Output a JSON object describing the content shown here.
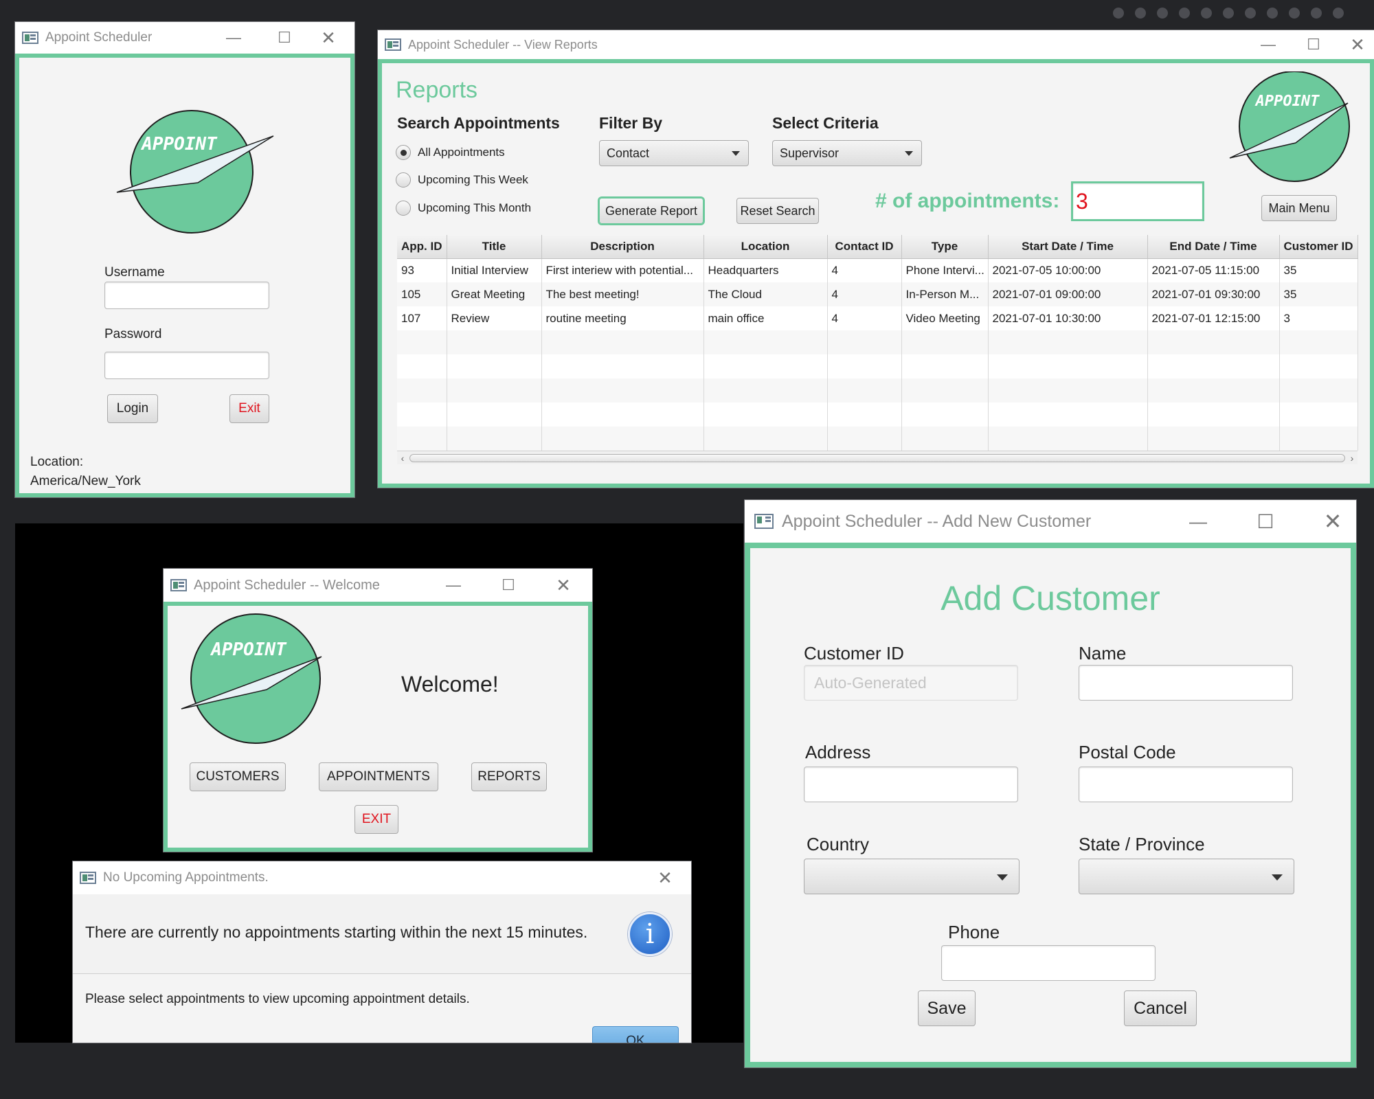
{
  "colors": {
    "accent": "#6cc99c",
    "background": "#242528",
    "danger": "#e0141e"
  },
  "logo": {
    "text": "APPOINT"
  },
  "login": {
    "title": "Appoint Scheduler",
    "username_label": "Username",
    "username_value": "",
    "password_label": "Password",
    "password_value": "",
    "login_button": "Login",
    "exit_button": "Exit",
    "location_label": "Location:",
    "location_value": "America/New_York"
  },
  "reports": {
    "window_title": "Appoint Scheduler -- View Reports",
    "heading": "Reports",
    "search_heading": "Search Appointments",
    "radios": [
      {
        "label": "All Appointments",
        "selected": true
      },
      {
        "label": "Upcoming This Week",
        "selected": false
      },
      {
        "label": "Upcoming This Month",
        "selected": false
      }
    ],
    "filter_label": "Filter By",
    "filter_value": "Contact",
    "criteria_label": "Select Criteria",
    "criteria_value": "Supervisor",
    "generate_button": "Generate Report",
    "reset_button": "Reset Search",
    "count_label": "# of appointments:",
    "count_value": "3",
    "main_menu_button": "Main Menu",
    "table": {
      "columns": [
        "App. ID",
        "Title",
        "Description",
        "Location",
        "Contact ID",
        "Type",
        "Start Date / Time",
        "End Date / Time",
        "Customer ID"
      ],
      "rows": [
        [
          "93",
          "Initial Interview",
          "First interiew with potential...",
          "Headquarters",
          "4",
          "Phone Intervi...",
          "2021-07-05 10:00:00",
          "2021-07-05 11:15:00",
          "35"
        ],
        [
          "105",
          "Great Meeting",
          "The best meeting!",
          "The Cloud",
          "4",
          "In-Person M...",
          "2021-07-01 09:00:00",
          "2021-07-01 09:30:00",
          "35"
        ],
        [
          "107",
          "Review",
          "routine meeting",
          "main office",
          "4",
          "Video Meeting",
          "2021-07-01 10:30:00",
          "2021-07-01 12:15:00",
          "3"
        ]
      ]
    }
  },
  "welcome": {
    "window_title": "Appoint Scheduler -- Welcome",
    "message": "Welcome!",
    "customers_button": "CUSTOMERS",
    "appointments_button": "APPOINTMENTS",
    "reports_button": "REPORTS",
    "exit_button": "EXIT"
  },
  "alert": {
    "window_title": "No Upcoming Appointments.",
    "header": "There are currently no appointments starting within the next 15 minutes.",
    "body": "Please select appointments to view upcoming appointment details.",
    "ok_button": "OK",
    "icon": "info-icon"
  },
  "add_customer": {
    "window_title": "Appoint Scheduler -- Add New Customer",
    "heading": "Add Customer",
    "customer_id_label": "Customer ID",
    "customer_id_placeholder": "Auto-Generated",
    "name_label": "Name",
    "name_value": "",
    "address_label": "Address",
    "address_value": "",
    "postal_label": "Postal Code",
    "postal_value": "",
    "country_label": "Country",
    "country_value": "",
    "state_label": "State / Province",
    "state_value": "",
    "phone_label": "Phone",
    "phone_value": "",
    "save_button": "Save",
    "cancel_button": "Cancel"
  },
  "window_controls": {
    "minimize": "—",
    "maximize": "☐",
    "close": "✕"
  }
}
